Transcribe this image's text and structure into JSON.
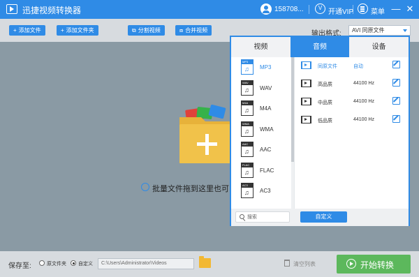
{
  "window": {
    "title": "迅捷视频转换器",
    "user_name": "158708...",
    "vip_label": "开通VIP",
    "menu_label": "菜单",
    "minimize_glyph": "—",
    "close_glyph": "✕"
  },
  "toolbar": {
    "add_file": "添加文件",
    "add_folder": "添加文件夹",
    "split_video": "分割视频",
    "merge_video": "合并视频",
    "output_format_label": "输出格式:",
    "output_format_value": "AVI  同原文件"
  },
  "drop_area": {
    "hint": "批量文件拖到这里也可"
  },
  "format_panel": {
    "tabs": [
      {
        "label": "视频",
        "active": false
      },
      {
        "label": "音频",
        "active": true
      },
      {
        "label": "设备",
        "active": false
      }
    ],
    "formats": [
      {
        "name": "MP3",
        "active": true
      },
      {
        "name": "WAV",
        "active": false
      },
      {
        "name": "M4A",
        "active": false
      },
      {
        "name": "WMA",
        "active": false
      },
      {
        "name": "AAC",
        "active": false
      },
      {
        "name": "FLAC",
        "active": false
      },
      {
        "name": "AC3",
        "active": false
      }
    ],
    "qualities": [
      {
        "name": "同原文件",
        "rate": "自动",
        "active": true
      },
      {
        "name": "高品质",
        "rate": "44100 Hz",
        "active": false
      },
      {
        "name": "中品质",
        "rate": "44100 Hz",
        "active": false
      },
      {
        "name": "低品质",
        "rate": "44100 Hz",
        "active": false
      }
    ],
    "search_placeholder": "搜索",
    "custom_button": "自定义"
  },
  "bottom": {
    "save_label": "保存至:",
    "option_original": "原文件夹",
    "option_custom": "自定义",
    "custom_checked": true,
    "path": "C:\\Users\\Administrator\\Videos",
    "clear_list": "清空列表",
    "start_button": "开始转换"
  },
  "colors": {
    "accent": "#2f8be6",
    "start_green": "#5cb85c",
    "folder_yellow": "#f2b833"
  }
}
